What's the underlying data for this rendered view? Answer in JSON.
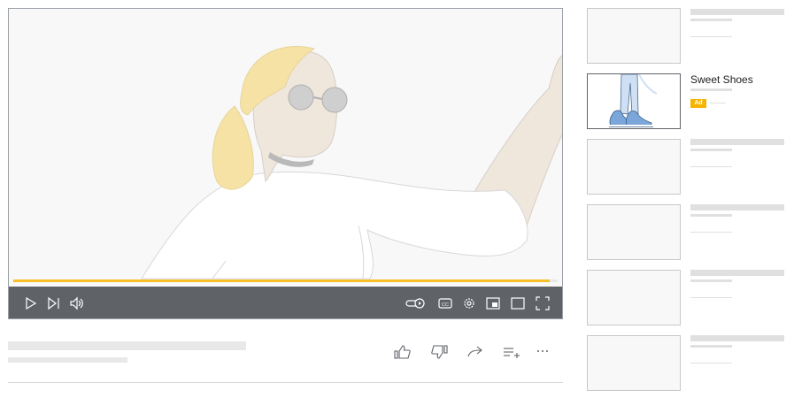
{
  "player": {
    "progress_fraction": 0.985,
    "controls": {
      "left": [
        "play-icon",
        "next-icon",
        "volume-icon"
      ],
      "right": [
        "autoplay-toggle-icon",
        "captions-icon",
        "settings-icon",
        "miniplayer-icon",
        "theater-mode-icon",
        "fullscreen-icon"
      ]
    },
    "colors": {
      "progress": "#f6c026",
      "controls_bg": "#5f6368",
      "hair": "#f7e2a6",
      "skin": "#efe6dc"
    }
  },
  "actions": [
    "like-icon",
    "dislike-icon",
    "share-icon",
    "save-to-playlist-icon",
    "more-icon"
  ],
  "sidebar": {
    "ad": {
      "title": "Sweet Shoes",
      "badge": "Ad"
    },
    "placeholder_count": 5
  }
}
